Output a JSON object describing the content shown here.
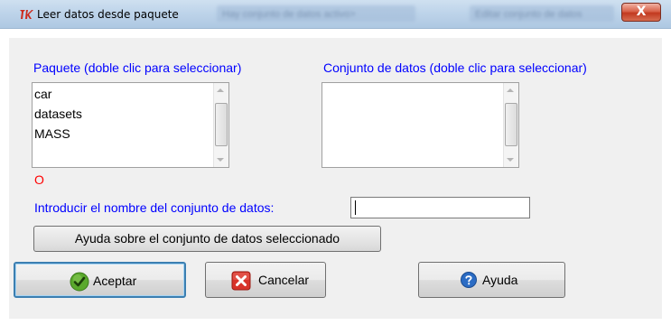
{
  "window": {
    "title": "Leer datos desde paquete",
    "close_label": "X",
    "background_tabs": [
      "Hay conjunto de datos activo>",
      "Editar conjunto de datos"
    ]
  },
  "packages": {
    "label": "Paquete (doble clic para seleccionar)",
    "items": [
      "car",
      "datasets",
      "MASS"
    ]
  },
  "datasets": {
    "label": "Conjunto de datos (doble clic para seleccionar)",
    "items": []
  },
  "status_text": "O",
  "dataset_name": {
    "label": "Introducir el nombre del conjunto de datos:",
    "value": ""
  },
  "help_dataset_button": "Ayuda sobre el conjunto de datos seleccionado",
  "buttons": {
    "ok": "Aceptar",
    "cancel": "Cancelar",
    "help": "Ayuda"
  },
  "colors": {
    "label_blue": "#0000ff",
    "status_red": "#ff0000",
    "ok_green": "#5aa92c",
    "cancel_red": "#d8332a",
    "help_blue": "#2b6cc4"
  },
  "icons": {
    "app": "tk-feather-icon",
    "ok": "green-check-icon",
    "cancel": "red-x-icon",
    "help": "blue-question-icon"
  }
}
